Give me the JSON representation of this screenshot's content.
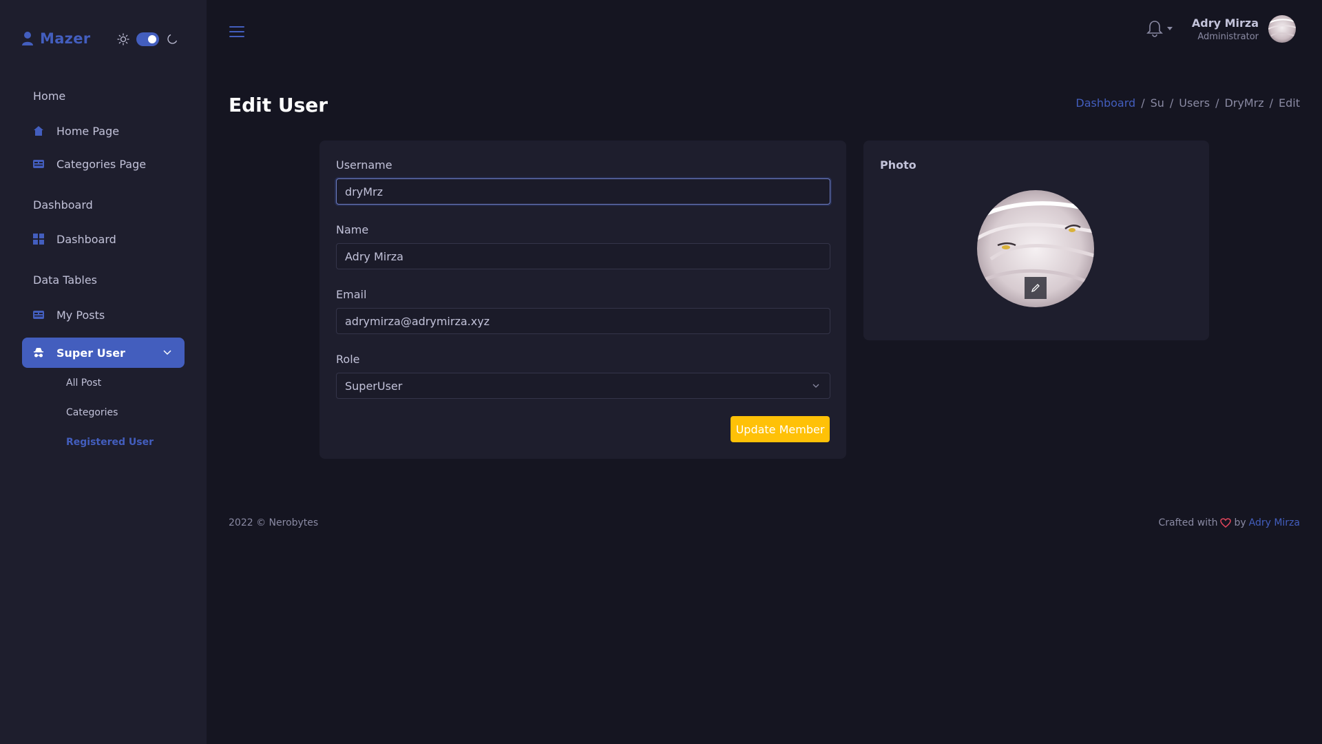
{
  "brand": {
    "name": "Mazer",
    "accent": "#435ebe"
  },
  "sidebar": {
    "sections": [
      {
        "title": "Home"
      },
      {
        "title": "Dashboard"
      },
      {
        "title": "Data Tables"
      }
    ],
    "items": [
      {
        "label": "Home Page",
        "icon": "house-icon"
      },
      {
        "label": "Categories Page",
        "icon": "card-icon"
      },
      {
        "label": "Dashboard",
        "icon": "grid-icon"
      },
      {
        "label": "My Posts",
        "icon": "card-icon"
      },
      {
        "label": "Super User",
        "icon": "incognito-icon",
        "active": true
      }
    ],
    "submenu": [
      {
        "label": "All Post"
      },
      {
        "label": "Categories"
      },
      {
        "label": "Registered User",
        "active": true
      }
    ]
  },
  "header": {
    "user_name": "Adry Mirza",
    "user_role": "Administrator"
  },
  "page": {
    "title": "Edit User",
    "breadcrumb": [
      "Dashboard",
      "Su",
      "Users",
      "DryMrz",
      "Edit"
    ]
  },
  "form": {
    "username_label": "Username",
    "username_value": "dryMrz",
    "name_label": "Name",
    "name_value": "Adry Mirza",
    "email_label": "Email",
    "email_value": "adrymirza@adrymirza.xyz",
    "role_label": "Role",
    "role_value": "SuperUser",
    "submit_label": "Update Member",
    "submit_color": "#ffc107"
  },
  "photo": {
    "title": "Photo"
  },
  "footer": {
    "copyright": "2022 © Nerobytes",
    "crafted_prefix": "Crafted with",
    "crafted_by": "by",
    "author": "Adry Mirza"
  }
}
